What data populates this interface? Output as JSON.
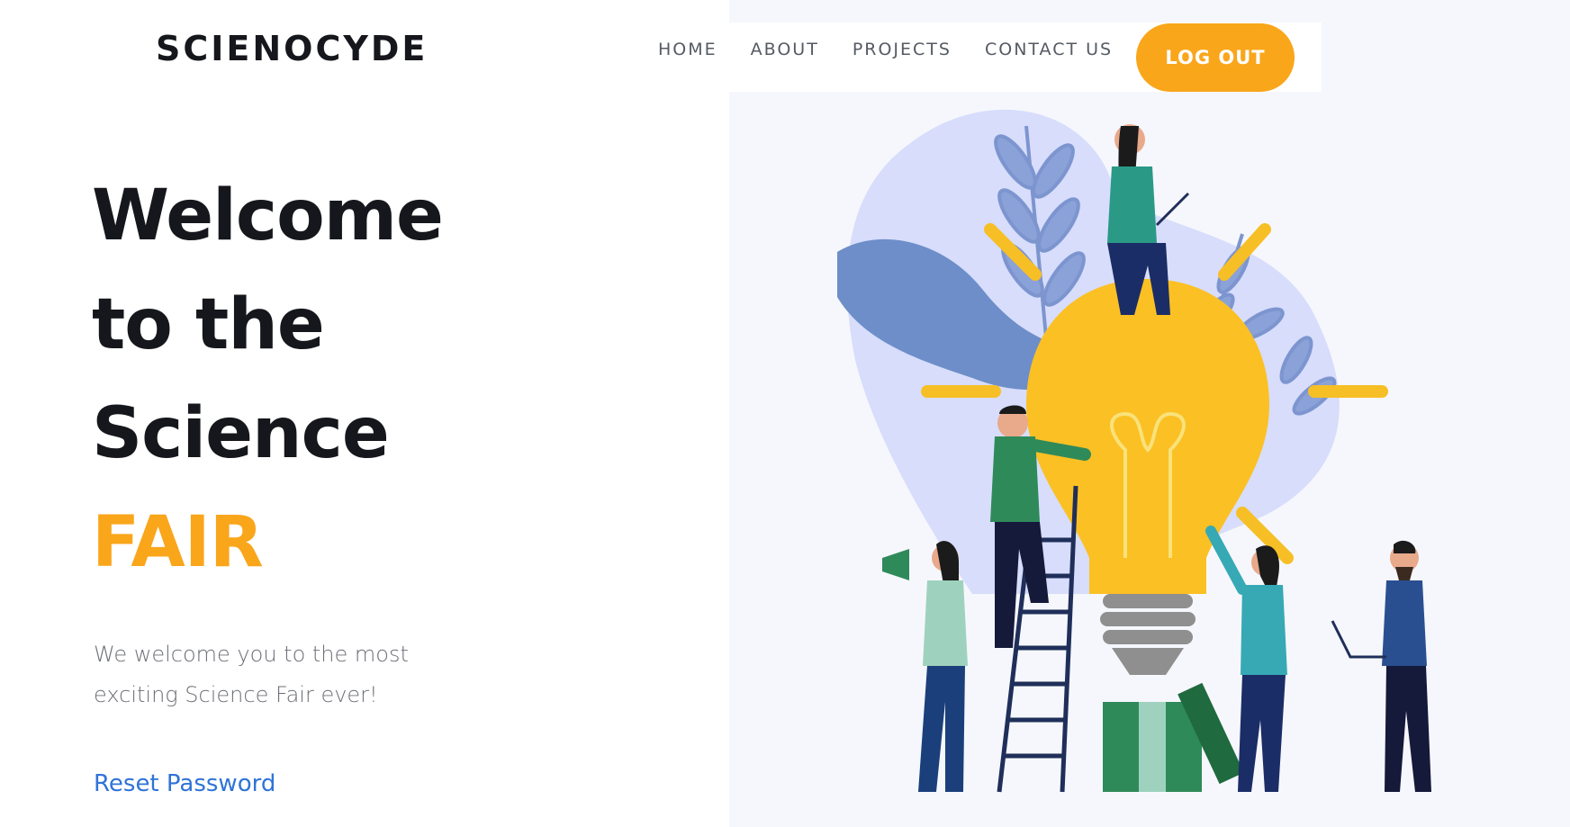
{
  "brand": {
    "name": "SCIENOCYDE"
  },
  "nav": {
    "items": [
      {
        "label": "HOME"
      },
      {
        "label": "ABOUT"
      },
      {
        "label": "PROJECTS"
      },
      {
        "label": "CONTACT US"
      }
    ],
    "logout_label": "LOG OUT"
  },
  "hero": {
    "title_lines": [
      "Welcome",
      "to the",
      "Science"
    ],
    "title_accent": "FAIR",
    "subtitle_line1": "We welcome you to the most",
    "subtitle_line2": "exciting Science Fair ever!",
    "reset_link": "Reset Password"
  },
  "colors": {
    "accent": "#f9a61b",
    "heading": "#15171c",
    "link": "#2f73d8",
    "illustration_bg": "#f6f7fc"
  },
  "illustration": {
    "subject": "lightbulb-teamwork-illustration"
  }
}
